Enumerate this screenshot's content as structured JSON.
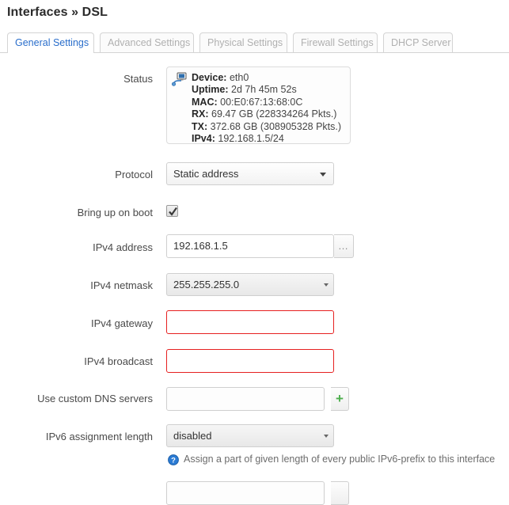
{
  "page": {
    "title": "Interfaces » DSL"
  },
  "tabs": [
    {
      "label": "General Settings",
      "active": true
    },
    {
      "label": "Advanced Settings",
      "active": false
    },
    {
      "label": "Physical Settings",
      "active": false
    },
    {
      "label": "Firewall Settings",
      "active": false
    },
    {
      "label": "DHCP Server",
      "active": false
    }
  ],
  "form": {
    "status": {
      "label": "Status",
      "icon": "ethernet-device-icon",
      "lines": [
        {
          "key": "Device:",
          "value": "eth0"
        },
        {
          "key": "Uptime:",
          "value": "2d 7h 45m 52s"
        },
        {
          "key": "MAC:",
          "value": "00:E0:67:13:68:0C"
        },
        {
          "key": "RX:",
          "value": "69.47 GB (228334264 Pkts.)"
        },
        {
          "key": "TX:",
          "value": "372.68 GB (308905328 Pkts.)"
        },
        {
          "key": "IPv4:",
          "value": "192.168.1.5/24"
        }
      ]
    },
    "protocol": {
      "label": "Protocol",
      "value": "Static address"
    },
    "bring_up_on_boot": {
      "label": "Bring up on boot",
      "checked": true
    },
    "ipv4_address": {
      "label": "IPv4 address",
      "value": "192.168.1.5",
      "button_label": "…"
    },
    "ipv4_netmask": {
      "label": "IPv4 netmask",
      "value": "255.255.255.0"
    },
    "ipv4_gateway": {
      "label": "IPv4 gateway",
      "value": "",
      "invalid": true
    },
    "ipv4_broadcast": {
      "label": "IPv4 broadcast",
      "value": "",
      "invalid": true
    },
    "custom_dns": {
      "label": "Use custom DNS servers",
      "value": "",
      "button_label": "+"
    },
    "ipv6_assignment_length": {
      "label": "IPv6 assignment length",
      "value": "disabled",
      "help": "Assign a part of given length of every public IPv6-prefix to this interface",
      "help_icon": "question-mark-icon"
    }
  },
  "colors": {
    "accent": "#2a6ecb",
    "error": "#e62020",
    "add": "#4cae4c",
    "help_icon": "#2b7bd4"
  }
}
